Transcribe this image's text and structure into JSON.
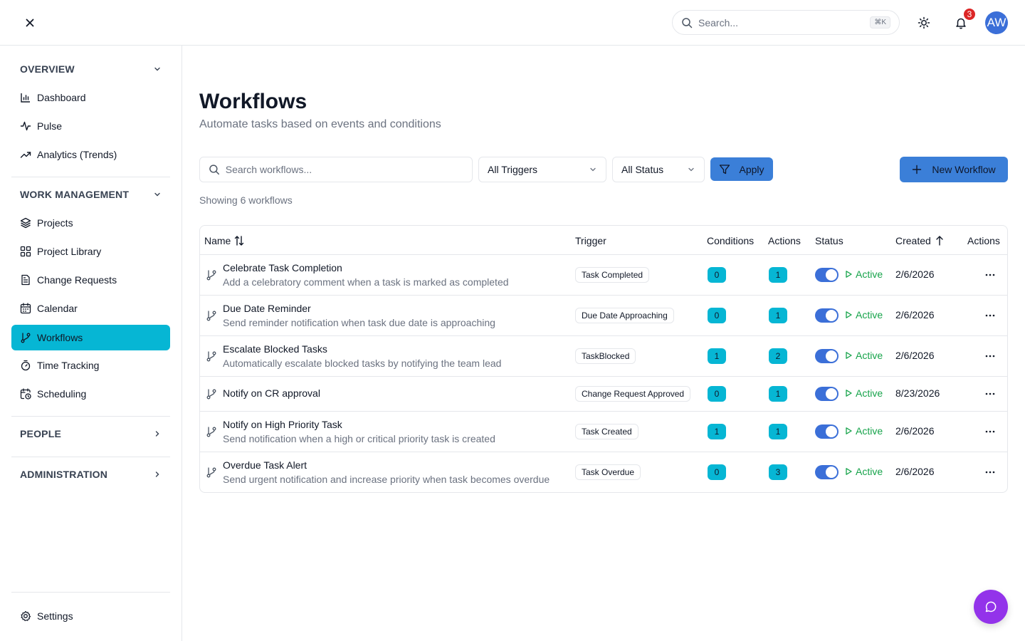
{
  "colors": {
    "accent": "#06b6d4",
    "primary": "#3b7fd8",
    "status_active": "#16a34a",
    "badge": "#dc2626",
    "fab": "#9333ea"
  },
  "topbar": {
    "search_placeholder": "Search...",
    "search_shortcut": "⌘K",
    "notification_count": "3",
    "avatar_initials": "AW"
  },
  "sidebar": {
    "sections": [
      {
        "label": "OVERVIEW",
        "expanded": true
      },
      {
        "label": "WORK MANAGEMENT",
        "expanded": true
      },
      {
        "label": "PEOPLE",
        "expanded": false
      },
      {
        "label": "ADMINISTRATION",
        "expanded": false
      }
    ],
    "items": [
      {
        "label": "Dashboard",
        "icon": "bar-chart-icon"
      },
      {
        "label": "Pulse",
        "icon": "activity-icon"
      },
      {
        "label": "Analytics (Trends)",
        "icon": "trending-up-icon"
      },
      {
        "label": "Projects",
        "icon": "layers-icon"
      },
      {
        "label": "Project Library",
        "icon": "grid-icon"
      },
      {
        "label": "Change Requests",
        "icon": "file-text-icon"
      },
      {
        "label": "Calendar",
        "icon": "calendar-icon"
      },
      {
        "label": "Workflows",
        "icon": "git-branch-icon",
        "active": true
      },
      {
        "label": "Time Tracking",
        "icon": "timer-icon"
      },
      {
        "label": "Scheduling",
        "icon": "calendar-clock-icon"
      }
    ],
    "settings_label": "Settings"
  },
  "main": {
    "title": "Workflows",
    "subtitle": "Automate tasks based on events and conditions",
    "search_placeholder": "Search workflows...",
    "trigger_filter": "All Triggers",
    "status_filter": "All Status",
    "apply_label": "Apply",
    "new_label": "New Workflow",
    "showing_text": "Showing 6 workflows"
  },
  "table": {
    "headers": {
      "name": "Name",
      "trigger": "Trigger",
      "conditions": "Conditions",
      "actions": "Actions",
      "status": "Status",
      "created": "Created",
      "row_actions": "Actions"
    },
    "rows": [
      {
        "name": "Celebrate Task Completion",
        "description": "Add a celebratory comment when a task is marked as completed",
        "trigger": "Task Completed",
        "conditions": "0",
        "actions": "1",
        "status": "Active",
        "created": "2/6/2026"
      },
      {
        "name": "Due Date Reminder",
        "description": "Send reminder notification when task due date is approaching",
        "trigger": "Due Date Approaching",
        "conditions": "0",
        "actions": "1",
        "status": "Active",
        "created": "2/6/2026"
      },
      {
        "name": "Escalate Blocked Tasks",
        "description": "Automatically escalate blocked tasks by notifying the team lead",
        "trigger": "TaskBlocked",
        "conditions": "1",
        "actions": "2",
        "status": "Active",
        "created": "2/6/2026"
      },
      {
        "name": "Notify on CR approval",
        "description": "",
        "trigger": "Change Request Approved",
        "conditions": "0",
        "actions": "1",
        "status": "Active",
        "created": "8/23/2026"
      },
      {
        "name": "Notify on High Priority Task",
        "description": "Send notification when a high or critical priority task is created",
        "trigger": "Task Created",
        "conditions": "1",
        "actions": "1",
        "status": "Active",
        "created": "2/6/2026"
      },
      {
        "name": "Overdue Task Alert",
        "description": "Send urgent notification and increase priority when task becomes overdue",
        "trigger": "Task Overdue",
        "conditions": "0",
        "actions": "3",
        "status": "Active",
        "created": "2/6/2026"
      }
    ]
  }
}
